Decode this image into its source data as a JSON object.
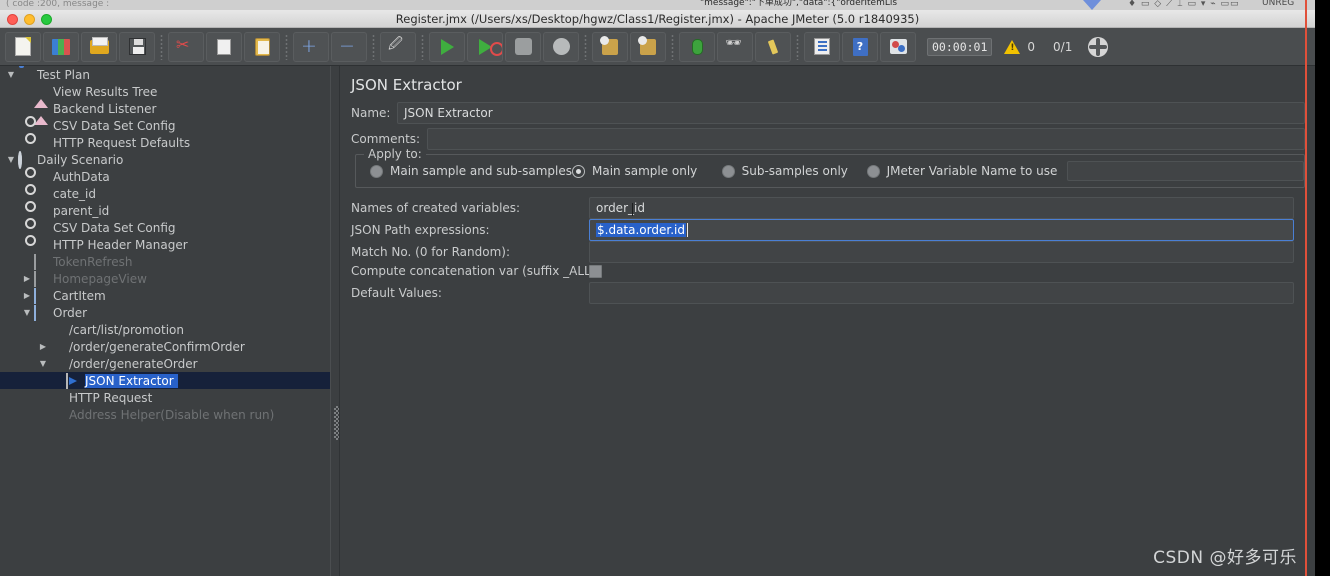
{
  "window": {
    "title": "Register.jmx (/Users/xs/Desktop/hgwz/Class1/Register.jmx) - Apache JMeter (5.0 r1840935)"
  },
  "background_window": {
    "left_fragment": "( code :200, message :",
    "mid_fragment": "\"message\":\"下单成功\",\"data\":{\"orderItemLis",
    "right_fragment": "UNREG",
    "tool_fragment": "♦ ▭ ◇ ⟋ ⌶ ▭ ▾ ⌁ ▭▭"
  },
  "toolbar": {
    "buttons": [
      {
        "name": "new-test-plan",
        "icon": "new-document-icon",
        "title": "New"
      },
      {
        "name": "templates",
        "icon": "templates-icon",
        "title": "Templates"
      },
      {
        "name": "open",
        "icon": "open-folder-icon",
        "title": "Open"
      },
      {
        "name": "save",
        "icon": "save-disk-icon",
        "title": "Save Test Plan"
      },
      {
        "name": "cut",
        "icon": "scissors-icon",
        "title": "Cut"
      },
      {
        "name": "copy",
        "icon": "copy-icon",
        "title": "Copy"
      },
      {
        "name": "paste",
        "icon": "clipboard-paste-icon",
        "title": "Paste"
      },
      {
        "name": "expand-all",
        "icon": "plus-icon",
        "title": "Expand All"
      },
      {
        "name": "collapse-all",
        "icon": "minus-icon",
        "title": "Collapse All"
      },
      {
        "name": "toggle",
        "icon": "toggle-icon",
        "title": "Toggle"
      },
      {
        "name": "start",
        "icon": "start-play-icon",
        "title": "Start"
      },
      {
        "name": "start-no-pauses",
        "icon": "start-no-pauses-icon",
        "title": "Start no pauses"
      },
      {
        "name": "stop",
        "icon": "stop-octagon-icon",
        "title": "Stop"
      },
      {
        "name": "shutdown",
        "icon": "shutdown-icon",
        "title": "Shutdown"
      },
      {
        "name": "clear",
        "icon": "clear-icon",
        "title": "Clear"
      },
      {
        "name": "clear-all",
        "icon": "clear-all-icon",
        "title": "Clear All"
      },
      {
        "name": "ssl-manager",
        "icon": "bug-icon",
        "title": "SSL Manager"
      },
      {
        "name": "search",
        "icon": "binoculars-icon",
        "title": "Search"
      },
      {
        "name": "reset-search",
        "icon": "broom-icon",
        "title": "Reset Search"
      },
      {
        "name": "function-helper",
        "icon": "function-list-icon",
        "title": "Function Helper Dialog"
      },
      {
        "name": "help",
        "icon": "help-book-icon",
        "title": "Help"
      },
      {
        "name": "undo-redo-extra",
        "icon": "package-icon",
        "title": "Extras"
      }
    ],
    "elapsed_time": "00:00:01",
    "warning_count": "0",
    "thread_count": "0/1",
    "remote_icon": "globe-icon"
  },
  "tree": {
    "items": [
      {
        "label": "Test Plan",
        "indent": 0,
        "twist": "▼",
        "icon": "test-plan-icon",
        "disabled": false,
        "selected": false
      },
      {
        "label": "View Results Tree",
        "indent": 1,
        "twist": "",
        "icon": "listener-icon",
        "disabled": false,
        "selected": false
      },
      {
        "label": "Backend Listener",
        "indent": 1,
        "twist": "",
        "icon": "listener-icon",
        "disabled": false,
        "selected": false
      },
      {
        "label": "CSV Data Set Config",
        "indent": 1,
        "twist": "",
        "icon": "config-element-icon",
        "disabled": false,
        "selected": false
      },
      {
        "label": "HTTP Request Defaults",
        "indent": 1,
        "twist": "",
        "icon": "config-element-icon",
        "disabled": false,
        "selected": false
      },
      {
        "label": "Daily Scenario",
        "indent": 0,
        "twist": "▼",
        "icon": "thread-group-icon",
        "disabled": false,
        "selected": false
      },
      {
        "label": "AuthData",
        "indent": 1,
        "twist": "",
        "icon": "config-element-icon",
        "disabled": false,
        "selected": false
      },
      {
        "label": "cate_id",
        "indent": 1,
        "twist": "",
        "icon": "config-element-icon",
        "disabled": false,
        "selected": false
      },
      {
        "label": "parent_id",
        "indent": 1,
        "twist": "",
        "icon": "config-element-icon",
        "disabled": false,
        "selected": false
      },
      {
        "label": "CSV Data Set Config",
        "indent": 1,
        "twist": "",
        "icon": "config-element-icon",
        "disabled": false,
        "selected": false
      },
      {
        "label": "HTTP Header Manager",
        "indent": 1,
        "twist": "",
        "icon": "config-element-icon",
        "disabled": false,
        "selected": false
      },
      {
        "label": "TokenRefresh",
        "indent": 1,
        "twist": "",
        "icon": "controller-icon",
        "disabled": true,
        "selected": false
      },
      {
        "label": "HomepageView",
        "indent": 1,
        "twist": "▶",
        "icon": "controller-icon",
        "disabled": true,
        "selected": false
      },
      {
        "label": "CartItem",
        "indent": 1,
        "twist": "▶",
        "icon": "controller-blue-icon",
        "disabled": false,
        "selected": false
      },
      {
        "label": "Order",
        "indent": 1,
        "twist": "▼",
        "icon": "controller-blue-icon",
        "disabled": false,
        "selected": false
      },
      {
        "label": "/cart/list/promotion",
        "indent": 2,
        "twist": "",
        "icon": "sampler-icon",
        "disabled": false,
        "selected": false
      },
      {
        "label": "/order/generateConfirmOrder",
        "indent": 2,
        "twist": "▶",
        "icon": "sampler-icon",
        "disabled": false,
        "selected": false
      },
      {
        "label": "/order/generateOrder",
        "indent": 2,
        "twist": "▼",
        "icon": "sampler-icon",
        "disabled": false,
        "selected": false
      },
      {
        "label": "JSON Extractor",
        "indent": 3,
        "twist": "",
        "icon": "post-processor-icon",
        "disabled": false,
        "selected": true
      },
      {
        "label": "HTTP Request",
        "indent": 2,
        "twist": "",
        "icon": "sampler-icon",
        "disabled": false,
        "selected": false
      },
      {
        "label": "Address Helper(Disable when run)",
        "indent": 2,
        "twist": "",
        "icon": "sampler-disabled-icon",
        "disabled": true,
        "selected": false
      }
    ]
  },
  "panel": {
    "title": "JSON Extractor",
    "name_label": "Name:",
    "name_value": "JSON Extractor",
    "comments_label": "Comments:",
    "comments_value": "",
    "apply_to_label": "Apply to:",
    "apply_to_options": [
      {
        "label": "Main sample and sub-samples",
        "selected": false
      },
      {
        "label": "Main sample only",
        "selected": true
      },
      {
        "label": "Sub-samples only",
        "selected": false
      },
      {
        "label": "JMeter Variable Name to use",
        "selected": false
      }
    ],
    "jmeter_variable_value": "",
    "fields": [
      {
        "label": "Names of created variables:",
        "value": "order_id",
        "focused": false,
        "selected_text": false
      },
      {
        "label": "JSON Path expressions:",
        "value": "$.data.order.id",
        "focused": true,
        "selected_text": true
      },
      {
        "label": "Match No. (0 for Random):",
        "value": "",
        "focused": false,
        "selected_text": false
      },
      {
        "label": "Default Values:",
        "value": "",
        "focused": false,
        "selected_text": false
      }
    ],
    "concat_label": "Compute concatenation var (suffix _ALL):",
    "concat_checked": false
  },
  "watermark": "CSDN @好多可乐",
  "colors": {
    "accent_blue": "#2861c9",
    "panel_bg": "#3c3f41",
    "toolbar_bg": "#4a4d4f",
    "selection_row": "#16213a",
    "annotation_red": "#e0503a",
    "focus_border": "#4a7fd4"
  }
}
